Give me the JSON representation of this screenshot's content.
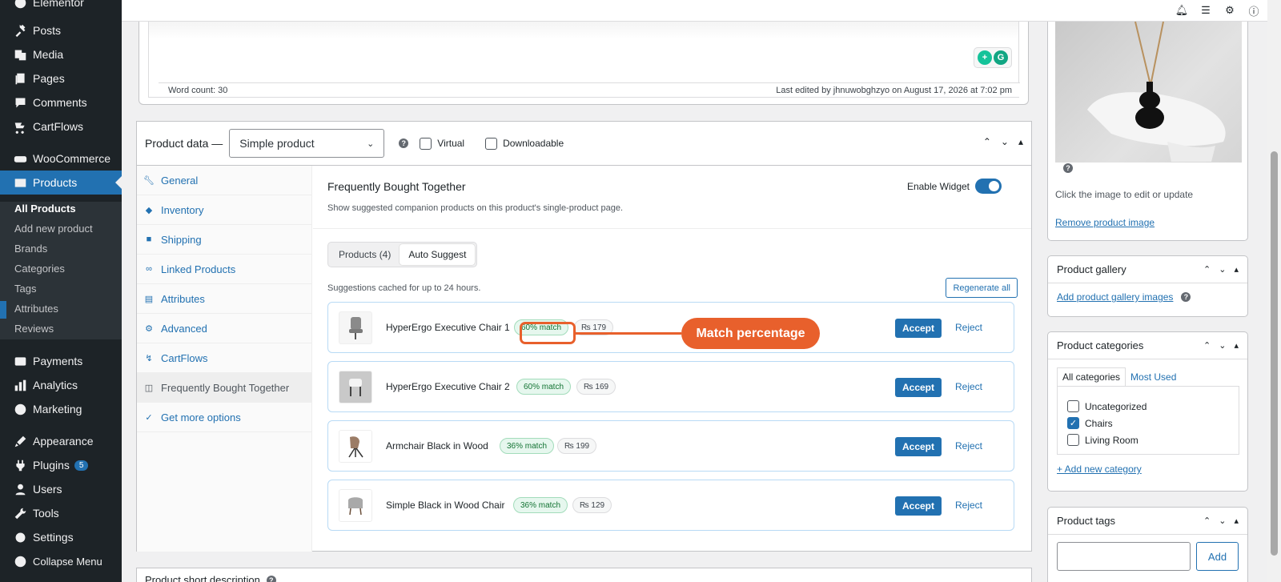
{
  "sidebar": {
    "top_item": "Elementor",
    "items": [
      {
        "label": "Posts",
        "icon": "pin-icon"
      },
      {
        "label": "Media",
        "icon": "media-icon"
      },
      {
        "label": "Pages",
        "icon": "pages-icon"
      },
      {
        "label": "Comments",
        "icon": "comments-icon"
      },
      {
        "label": "CartFlows",
        "icon": "cartflows-icon"
      },
      {
        "label": "WooCommerce",
        "icon": "woocommerce-icon"
      },
      {
        "label": "Products",
        "icon": "products-icon"
      },
      {
        "label": "Payments",
        "icon": "payments-icon"
      },
      {
        "label": "Analytics",
        "icon": "analytics-icon"
      },
      {
        "label": "Marketing",
        "icon": "marketing-icon"
      },
      {
        "label": "Appearance",
        "icon": "appearance-icon"
      },
      {
        "label": "Plugins",
        "icon": "plugins-icon",
        "badge": "5"
      },
      {
        "label": "Users",
        "icon": "users-icon"
      },
      {
        "label": "Tools",
        "icon": "tools-icon"
      },
      {
        "label": "Settings",
        "icon": "settings-icon"
      },
      {
        "label": "Collapse Menu",
        "icon": "collapse-icon"
      }
    ],
    "submenu": [
      "All Products",
      "Add new product",
      "Brands",
      "Categories",
      "Tags",
      "Attributes",
      "Reviews"
    ]
  },
  "editor": {
    "word_count": "Word count: 30",
    "last_edited": "Last edited by jhnuwobghzyo on August 17, 2026 at 7:02 pm"
  },
  "product_data": {
    "title": "Product data —",
    "type_select": "Simple product",
    "virtual_label": "Virtual",
    "downloadable_label": "Downloadable",
    "tabs": [
      {
        "label": "General",
        "icon": "wrench-icon"
      },
      {
        "label": "Inventory",
        "icon": "tag-icon"
      },
      {
        "label": "Shipping",
        "icon": "truck-icon"
      },
      {
        "label": "Linked Products",
        "icon": "link-icon"
      },
      {
        "label": "Attributes",
        "icon": "list-icon"
      },
      {
        "label": "Advanced",
        "icon": "gear-icon"
      },
      {
        "label": "CartFlows",
        "icon": "cartflows-icon"
      },
      {
        "label": "Frequently Bought Together",
        "icon": "cart-icon"
      },
      {
        "label": "Get more options",
        "icon": "plugin-icon"
      }
    ]
  },
  "fbt": {
    "title": "Frequently Bought Together",
    "subtitle": "Show suggested companion products on this product's single-product page.",
    "enable_label": "Enable Widget",
    "seg_products": "Products (4)",
    "seg_auto": "Auto Suggest",
    "cache_note": "Suggestions cached for up to 24 hours.",
    "regenerate": "Regenerate all",
    "accept": "Accept",
    "reject": "Reject",
    "suggestions": [
      {
        "name": "HyperErgo Executive Chair 1",
        "match": "60% match",
        "price": "₨ 179"
      },
      {
        "name": "HyperErgo Executive Chair 2",
        "match": "60% match",
        "price": "₨ 169"
      },
      {
        "name": "Armchair Black in Wood",
        "match": "36% match",
        "price": "₨ 199"
      },
      {
        "name": "Simple Black in Wood Chair",
        "match": "36% match",
        "price": "₨ 129"
      }
    ],
    "callout": "Match percentage"
  },
  "short_description": "Product short description",
  "right": {
    "image_help": "Click the image to edit or update",
    "remove_image": "Remove product image",
    "gallery_title": "Product gallery",
    "gallery_add": "Add product gallery images",
    "categories_title": "Product categories",
    "cat_tab_all": "All categories",
    "cat_tab_used": "Most Used",
    "categories": [
      {
        "label": "Uncategorized",
        "checked": false
      },
      {
        "label": "Chairs",
        "checked": true
      },
      {
        "label": "Living Room",
        "checked": false
      }
    ],
    "add_category": "+ Add new category",
    "tags_title": "Product tags",
    "tags_add": "Add"
  },
  "colors": {
    "accent": "#2271b1",
    "callout": "#e8602c",
    "sidebar": "#1d2327"
  }
}
